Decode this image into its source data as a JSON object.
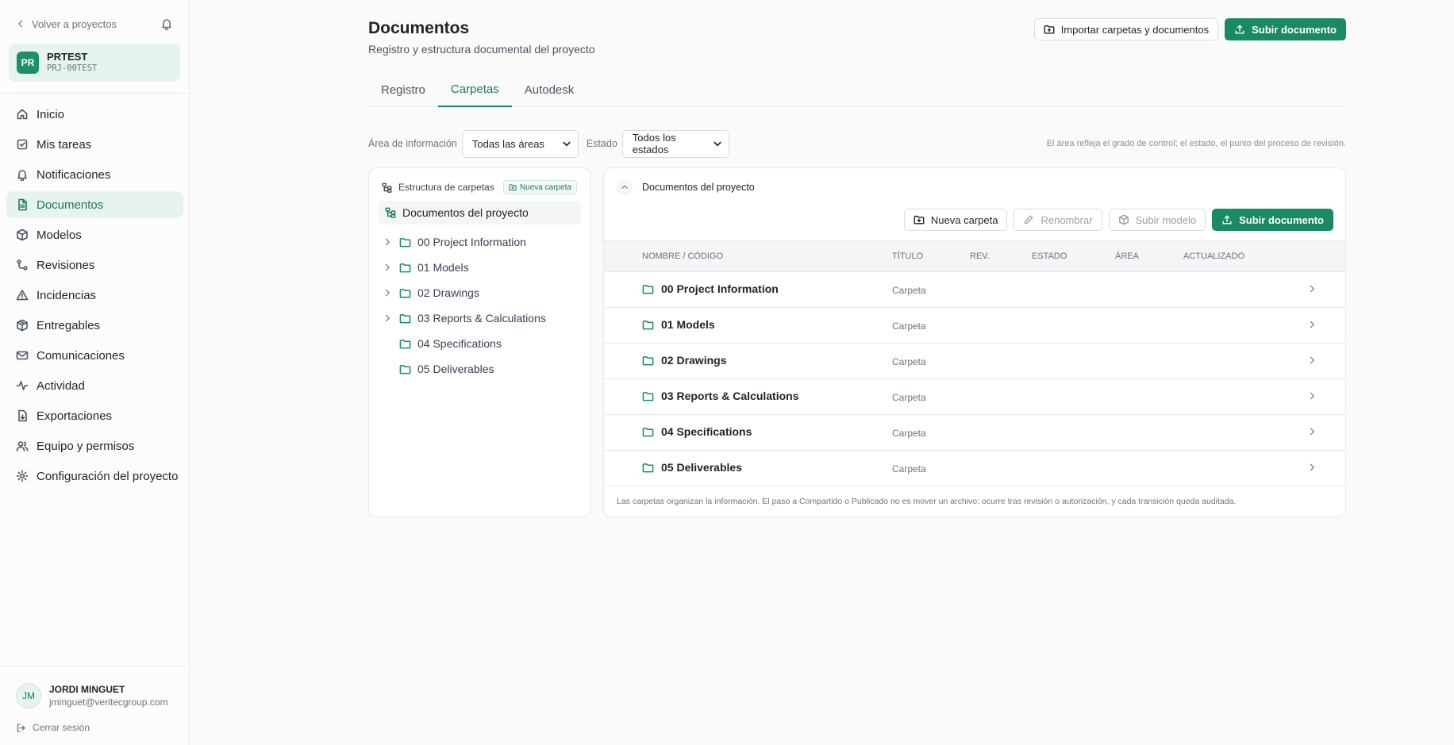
{
  "sidebar": {
    "back_label": "Volver a proyectos",
    "project": {
      "initials": "PR",
      "name": "PRTEST",
      "code": "PRJ-00TEST"
    },
    "nav": [
      {
        "label": "Inicio",
        "icon": "home-icon",
        "active": false
      },
      {
        "label": "Mis tareas",
        "icon": "checkbox-icon",
        "active": false
      },
      {
        "label": "Notificaciones",
        "icon": "bell-icon",
        "active": false
      },
      {
        "label": "Documentos",
        "icon": "file-icon",
        "active": true
      },
      {
        "label": "Modelos",
        "icon": "cube-icon",
        "active": false
      },
      {
        "label": "Revisiones",
        "icon": "git-icon",
        "active": false
      },
      {
        "label": "Incidencias",
        "icon": "warning-icon",
        "active": false
      },
      {
        "label": "Entregables",
        "icon": "package-icon",
        "active": false
      },
      {
        "label": "Comunicaciones",
        "icon": "mail-icon",
        "active": false
      },
      {
        "label": "Actividad",
        "icon": "activity-icon",
        "active": false
      },
      {
        "label": "Exportaciones",
        "icon": "export-icon",
        "active": false
      },
      {
        "label": "Equipo y permisos",
        "icon": "users-icon",
        "active": false
      },
      {
        "label": "Configuración del proyecto",
        "icon": "gear-icon",
        "active": false
      }
    ],
    "user": {
      "initials": "JM",
      "name": "JORDI MINGUET",
      "email": "jminguet@veritecgroup.com"
    },
    "logout_label": "Cerrar sesión"
  },
  "header": {
    "title": "Documentos",
    "subtitle": "Registro y estructura documental del proyecto",
    "import_label": "Importar carpetas y documentos",
    "upload_label": "Subir documento"
  },
  "tabs": [
    {
      "label": "Registro",
      "active": false
    },
    {
      "label": "Carpetas",
      "active": true
    },
    {
      "label": "Autodesk",
      "active": false
    }
  ],
  "filters": {
    "area_label": "Área de información",
    "area_value": "Todas las áreas",
    "status_label": "Estado",
    "status_value": "Todos los estados",
    "hint": "El área refleja el grado de control; el estado, el punto del proceso de revisión."
  },
  "tree": {
    "heading": "Estructura de carpetas",
    "new_folder_label": "Nueva carpeta",
    "root_label": "Documentos del proyecto",
    "items": [
      {
        "label": "00 Project Information",
        "expandable": true
      },
      {
        "label": "01 Models",
        "expandable": true
      },
      {
        "label": "02 Drawings",
        "expandable": true
      },
      {
        "label": "03 Reports & Calculations",
        "expandable": true
      },
      {
        "label": "04 Specifications",
        "expandable": false
      },
      {
        "label": "05 Deliverables",
        "expandable": false
      }
    ]
  },
  "content": {
    "title": "Documentos del proyecto",
    "actions": {
      "new_folder": "Nueva carpeta",
      "rename": "Renombrar",
      "upload_model": "Subir modelo",
      "upload_document": "Subir documento"
    },
    "columns": [
      "NOMBRE / CÓDIGO",
      "TÍTULO",
      "REV.",
      "ESTADO",
      "ÁREA",
      "ACTUALIZADO"
    ],
    "rows": [
      {
        "name": "00 Project Information",
        "title": "Carpeta"
      },
      {
        "name": "01 Models",
        "title": "Carpeta"
      },
      {
        "name": "02 Drawings",
        "title": "Carpeta"
      },
      {
        "name": "03 Reports & Calculations",
        "title": "Carpeta"
      },
      {
        "name": "04 Specifications",
        "title": "Carpeta"
      },
      {
        "name": "05 Deliverables",
        "title": "Carpeta"
      }
    ],
    "footnote": "Las carpetas organizan la información. El paso a Compartido o Publicado no es mover un archivo: ocurre tras revisión o autorización, y cada transición queda auditada."
  },
  "colors": {
    "accent": "#1a8a64",
    "accent_soft": "#e7f3ee"
  }
}
